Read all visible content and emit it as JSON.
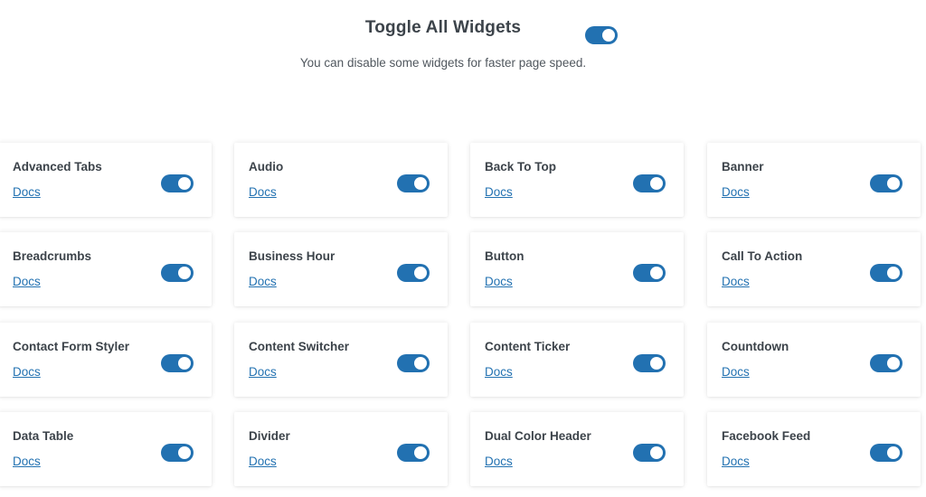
{
  "header": {
    "title": "Toggle All Widgets",
    "description": "You can disable some widgets for faster page speed.",
    "toggle_all_enabled": true
  },
  "colors": {
    "toggle_on": "#2271b1",
    "link": "#2271b1",
    "text": "#3c434a"
  },
  "widgets": [
    {
      "name": "Advanced Tabs",
      "docs": "Docs",
      "enabled": true
    },
    {
      "name": "Audio",
      "docs": "Docs",
      "enabled": true
    },
    {
      "name": "Back To Top",
      "docs": "Docs",
      "enabled": true
    },
    {
      "name": "Banner",
      "docs": "Docs",
      "enabled": true
    },
    {
      "name": "Breadcrumbs",
      "docs": "Docs",
      "enabled": true
    },
    {
      "name": "Business Hour",
      "docs": "Docs",
      "enabled": true
    },
    {
      "name": "Button",
      "docs": "Docs",
      "enabled": true
    },
    {
      "name": "Call To Action",
      "docs": "Docs",
      "enabled": true
    },
    {
      "name": "Contact Form Styler",
      "docs": "Docs",
      "enabled": true
    },
    {
      "name": "Content Switcher",
      "docs": "Docs",
      "enabled": true
    },
    {
      "name": "Content Ticker",
      "docs": "Docs",
      "enabled": true
    },
    {
      "name": "Countdown",
      "docs": "Docs",
      "enabled": true
    },
    {
      "name": "Data Table",
      "docs": "Docs",
      "enabled": true
    },
    {
      "name": "Divider",
      "docs": "Docs",
      "enabled": true
    },
    {
      "name": "Dual Color Header",
      "docs": "Docs",
      "enabled": true
    },
    {
      "name": "Facebook Feed",
      "docs": "Docs",
      "enabled": true
    }
  ]
}
